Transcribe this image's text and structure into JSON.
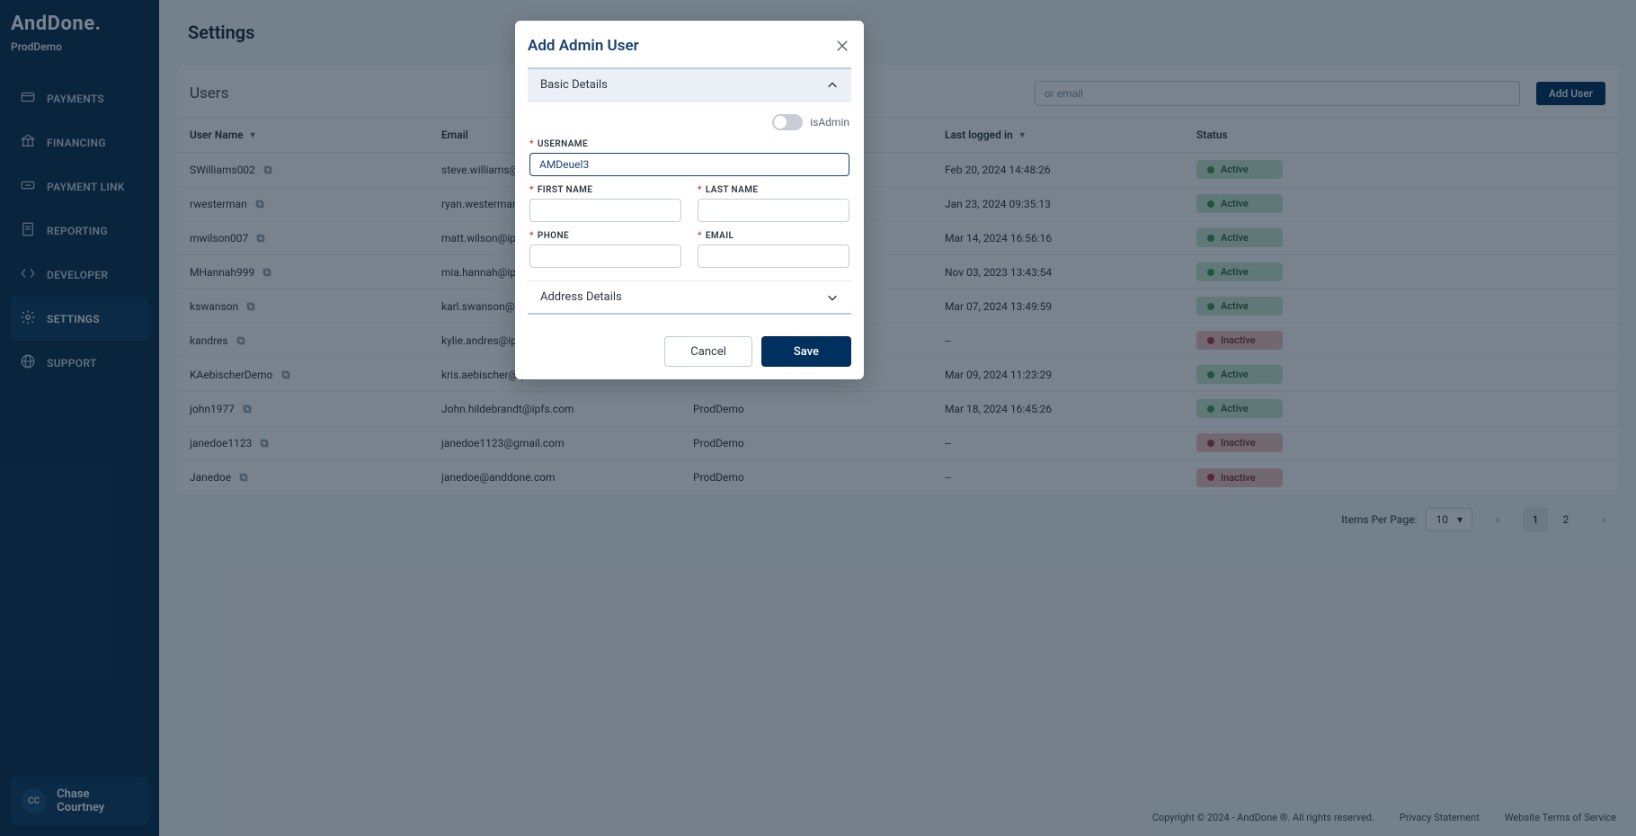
{
  "brand": "AndDone.",
  "tenant": "ProdDemo",
  "nav": [
    {
      "label": "PAYMENTS",
      "icon": "payments"
    },
    {
      "label": "FINANCING",
      "icon": "bank"
    },
    {
      "label": "PAYMENT LINK",
      "icon": "link"
    },
    {
      "label": "REPORTING",
      "icon": "report"
    },
    {
      "label": "DEVELOPER",
      "icon": "code"
    },
    {
      "label": "SETTINGS",
      "icon": "gear",
      "active": true
    },
    {
      "label": "SUPPORT",
      "icon": "globe"
    }
  ],
  "current_user": {
    "initials": "CC",
    "name": "Chase Courtney"
  },
  "page": {
    "title": "Settings",
    "section_title": "Users"
  },
  "search": {
    "placeholder": "or email"
  },
  "add_button": "Add User",
  "columns": {
    "username": "User Name",
    "email": "Email",
    "last_login": "Last logged in",
    "status": "Status"
  },
  "rows": [
    {
      "username": "SWilliams002",
      "email": "steve.williams@ipfs",
      "tenant": "",
      "last_login": "Feb 20, 2024 14:48:26",
      "status": "Active"
    },
    {
      "username": "rwesterman",
      "email": "ryan.westerman@ipfs",
      "tenant": "",
      "last_login": "Jan 23, 2024 09:35:13",
      "status": "Active"
    },
    {
      "username": "mwilson007",
      "email": "matt.wilson@ipfs",
      "tenant": "",
      "last_login": "Mar 14, 2024 16:56:16",
      "status": "Active"
    },
    {
      "username": "MHannah999",
      "email": "mia.hannah@ipfs",
      "tenant": "",
      "last_login": "Nov 03, 2023 13:43:54",
      "status": "Active"
    },
    {
      "username": "kswanson",
      "email": "karl.swanson@ipfs",
      "tenant": "",
      "last_login": "Mar 07, 2024 13:49:59",
      "status": "Active"
    },
    {
      "username": "kandres",
      "email": "kylie.andres@ipfs",
      "tenant": "",
      "last_login": "--",
      "status": "Inactive"
    },
    {
      "username": "KAebischerDemo",
      "email": "kris.aebischer@ipfs",
      "tenant": "",
      "last_login": "Mar 09, 2024 11:23:29",
      "status": "Active"
    },
    {
      "username": "john1977",
      "email": "John.hildebrandt@ipfs.com",
      "tenant": "ProdDemo",
      "last_login": "Mar 18, 2024 16:45:26",
      "status": "Active"
    },
    {
      "username": "janedoe1123",
      "email": "janedoe1123@gmail.com",
      "tenant": "ProdDemo",
      "last_login": "--",
      "status": "Inactive"
    },
    {
      "username": "Janedoe",
      "email": "janedoe@anddone.com",
      "tenant": "ProdDemo",
      "last_login": "--",
      "status": "Inactive"
    }
  ],
  "pager": {
    "label": "Items Per Page:",
    "per_page": "10",
    "pages": [
      "1",
      "2"
    ],
    "current": "1"
  },
  "footer": {
    "copyright": "Copyright © 2024 - AndDone ®. All rights reserved.",
    "privacy": "Privacy Statement",
    "terms": "Website Terms of Service"
  },
  "modal": {
    "title": "Add Admin User",
    "section_basic": "Basic Details",
    "section_address": "Address Details",
    "toggle_label": "isAdmin",
    "labels": {
      "username": "USERNAME",
      "first_name": "FIRST NAME",
      "last_name": "LAST NAME",
      "phone": "PHONE",
      "email": "EMAIL"
    },
    "values": {
      "username": "AMDeuel3"
    },
    "buttons": {
      "cancel": "Cancel",
      "save": "Save"
    }
  }
}
